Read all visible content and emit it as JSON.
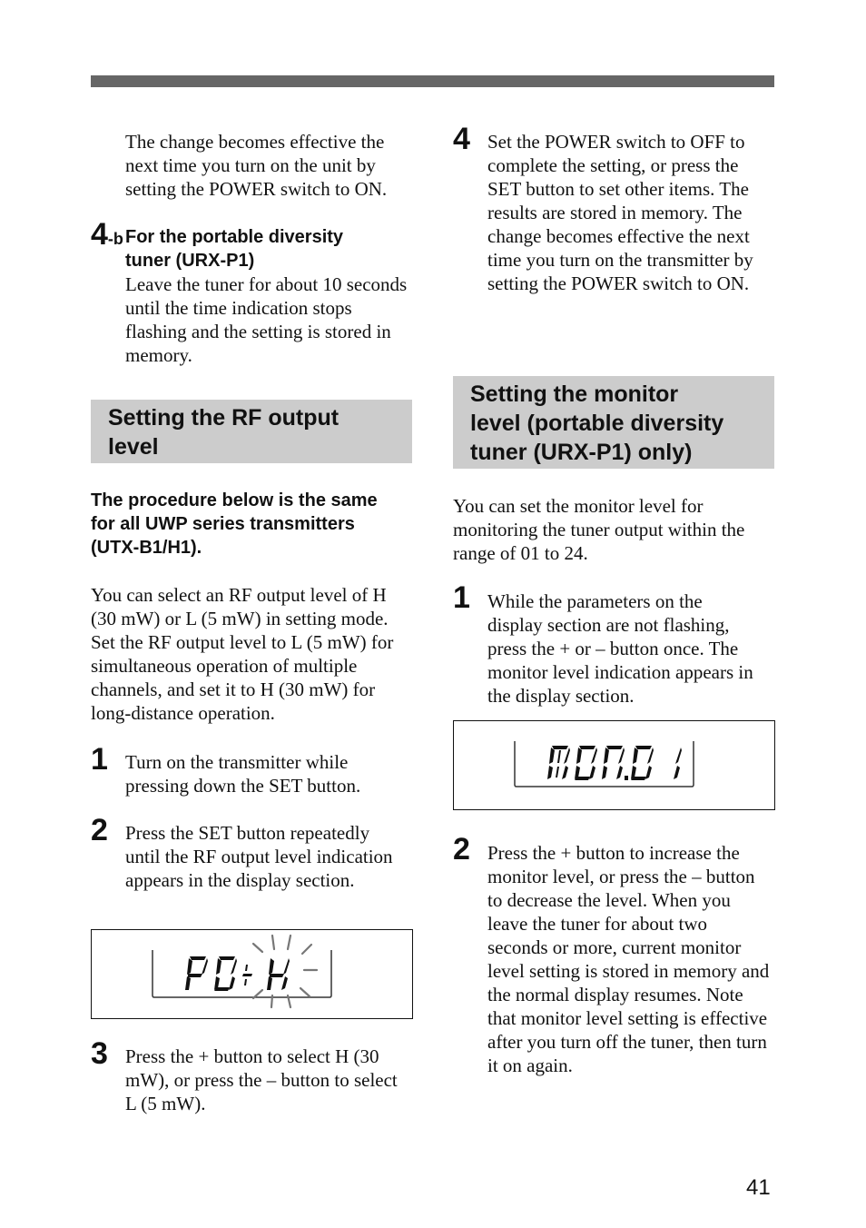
{
  "page": {
    "page_number": "41"
  },
  "left_column": {
    "intro_paragraph": "The change becomes effective the next time you turn on the unit by setting the POWER switch to ON.",
    "step_4b": {
      "number": "4",
      "suffix": "-b",
      "title_line1": "For the portable diversity",
      "title_line2": "tuner (URX-P1)",
      "body": "Leave the tuner for about 10 seconds until the time indication stops flashing and the setting is stored in memory."
    },
    "section_heading": {
      "line1": "Setting the RF output",
      "line2": "level"
    },
    "bold_intro": "The procedure below is the same for all UWP series transmitters (UTX-B1/H1).",
    "description": "You can select an RF output level of H (30 mW) or L (5 mW) in setting mode.  Set the RF output level to L (5 mW) for simultaneous operation of multiple channels, and set it to H (30 mW) for long-distance operation.",
    "steps": [
      {
        "number": "1",
        "text": "Turn on the transmitter while pressing down the SET button."
      },
      {
        "number": "2",
        "text": "Press the SET button repeatedly until the RF output level indication appears in the display section."
      },
      {
        "number": "3",
        "text": "Press the + button to select H (30 mW), or press the – button to select L (5 mW)."
      }
    ],
    "display": {
      "text": "P0:H",
      "highlight_blinking": "H"
    }
  },
  "right_column": {
    "step_4": {
      "number": "4",
      "text": "Set the POWER switch to OFF to complete the setting, or press the SET button to set other items. The results are stored in memory. The change becomes effective the next time you turn on the transmitter by setting the POWER switch to ON."
    },
    "section_heading": {
      "line1": "Setting the monitor",
      "line2": "level (portable diversity",
      "line3": "tuner (URX-P1) only)"
    },
    "description": "You can set the monitor level for monitoring the tuner output within the range of 01 to 24.",
    "steps": [
      {
        "number": "1",
        "text": "While the parameters on the display section are not flashing, press the + or – button once. The monitor level indication appears in the display section."
      },
      {
        "number": "2",
        "text": "Press the + button to increase the monitor level, or press the – button to decrease the level. When you leave the tuner for about two seconds or more, current monitor level setting is stored in memory and the normal display resumes. Note that monitor level setting is effective after you turn off the tuner, then turn it on again."
      }
    ],
    "display": {
      "text": "MON.01"
    }
  }
}
